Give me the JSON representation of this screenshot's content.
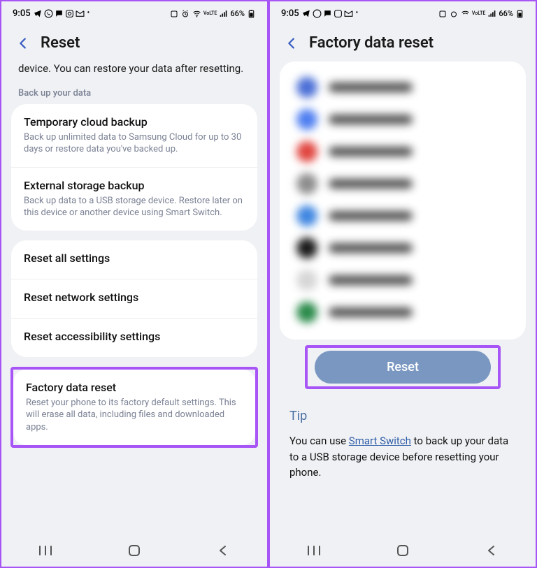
{
  "status": {
    "time": "9:05",
    "battery": "66%"
  },
  "left_phone": {
    "title": "Reset",
    "intro": "device. You can restore your data after resetting.",
    "section_label": "Back up your data",
    "backup": [
      {
        "title": "Temporary cloud backup",
        "desc": "Back up unlimited data to Samsung Cloud for up to 30 days or restore data you've backed up."
      },
      {
        "title": "External storage backup",
        "desc": "Back up data to a USB storage device. Restore later on this device or another device using Smart Switch."
      }
    ],
    "reset_options": [
      {
        "title": "Reset all settings"
      },
      {
        "title": "Reset network settings"
      },
      {
        "title": "Reset accessibility settings"
      }
    ],
    "factory": {
      "title": "Factory data reset",
      "desc": "Reset your phone to its factory default settings. This will erase all data, including files and downloaded apps."
    }
  },
  "right_phone": {
    "title": "Factory data reset",
    "apps": [
      {
        "color": "#4b6fd6"
      },
      {
        "color": "#4e7ef0"
      },
      {
        "color": "#e0453f"
      },
      {
        "color": "#8c8c8c"
      },
      {
        "color": "#3f86e0"
      },
      {
        "color": "#1a1a1a"
      },
      {
        "color": "#d6d6d6"
      },
      {
        "color": "#2a8a4a"
      }
    ],
    "reset_button": "Reset",
    "tip_label": "Tip",
    "tip_text_before": "You can use ",
    "tip_link": "Smart Switch",
    "tip_text_after": " to back up your data to a USB storage device before resetting your phone."
  }
}
